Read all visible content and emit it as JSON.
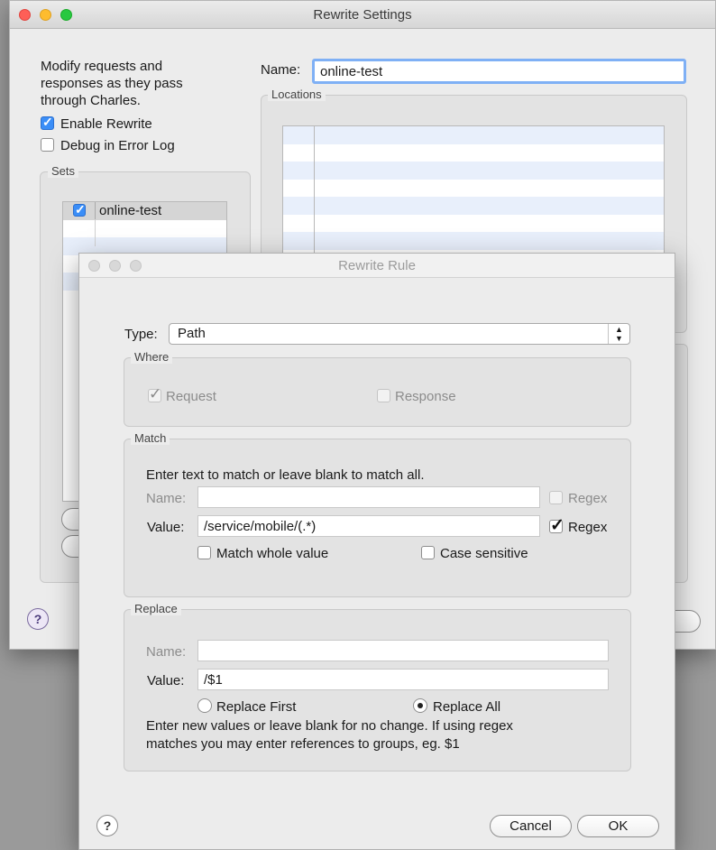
{
  "rewrite_settings": {
    "title": "Rewrite Settings",
    "description_lines": [
      "Modify requests and",
      "responses as they pass",
      "through Charles."
    ],
    "enable_rewrite_label": "Enable Rewrite",
    "debug_label": "Debug in Error Log",
    "sets_group_label": "Sets",
    "sets": [
      {
        "name": "online-test",
        "checked": true
      }
    ],
    "name_label": "Name:",
    "name_value": "online-test",
    "locations_group_label": "Locations",
    "help_label": "?"
  },
  "rewrite_rule": {
    "title": "Rewrite Rule",
    "type_label": "Type:",
    "type_value": "Path",
    "where": {
      "group_label": "Where",
      "request_label": "Request",
      "response_label": "Response"
    },
    "match": {
      "group_label": "Match",
      "instructions": "Enter text to match or leave blank to match all.",
      "name_label": "Name:",
      "name_value": "",
      "name_regex_label": "Regex",
      "value_label": "Value:",
      "value_value": "/service/mobile/(.*)",
      "value_regex_label": "Regex",
      "match_whole_label": "Match whole value",
      "case_sensitive_label": "Case sensitive"
    },
    "replace": {
      "group_label": "Replace",
      "name_label": "Name:",
      "name_value": "",
      "value_label": "Value:",
      "value_value": "/$1",
      "replace_first_label": "Replace First",
      "replace_all_label": "Replace All",
      "note_line1": "Enter new values or leave blank for no change. If using regex",
      "note_line2": "matches you may enter references to groups, eg. $1"
    },
    "help_label": "?",
    "cancel_label": "Cancel",
    "ok_label": "OK"
  },
  "colors": {
    "close": "#fe5f57",
    "minimize": "#febc2e",
    "zoom": "#28c840",
    "checkbox_blue": "#3b8ef7",
    "row_stripe": "#e8effb"
  }
}
